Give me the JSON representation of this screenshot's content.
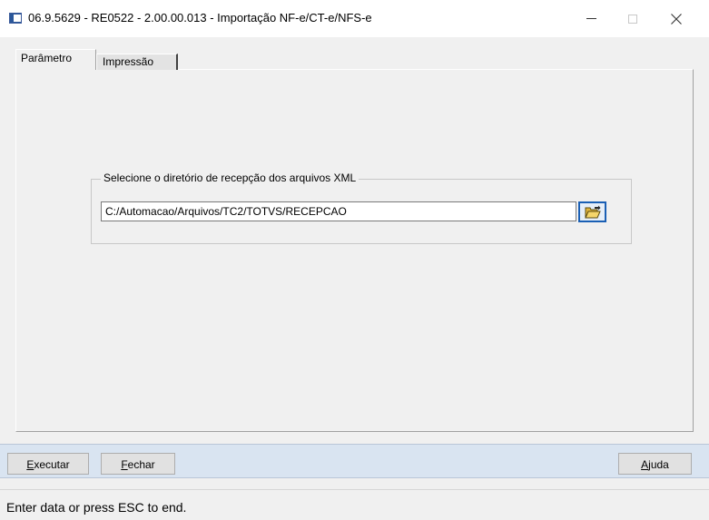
{
  "window": {
    "title": "06.9.5629 - RE0522 - 2.00.00.013 - Importação NF-e/CT-e/NFS-e",
    "controls": {
      "minimize": "—",
      "maximize": "□",
      "close": "✕"
    }
  },
  "tabs": [
    {
      "label": "Parâmetro",
      "selected": true
    },
    {
      "label": "Impressão",
      "selected": false
    }
  ],
  "parametro": {
    "group_label": "Selecione o diretório de recepção dos arquivos XML",
    "directory_value": "C:/Automacao/Arquivos/TC2/TOTVS/RECEPCAO",
    "browse_icon": "open-folder-icon"
  },
  "buttons": {
    "executar": {
      "mnemonic": "E",
      "rest": "xecutar"
    },
    "fechar": {
      "mnemonic": "F",
      "rest": "echar"
    },
    "ajuda": {
      "mnemonic": "A",
      "rest": "juda"
    }
  },
  "status": {
    "text": "Enter data or press ESC to end."
  },
  "colors": {
    "button_bar": "#d9e4f1",
    "panel_bg": "#f0f0f0",
    "focus_border": "#1a5fb4"
  }
}
